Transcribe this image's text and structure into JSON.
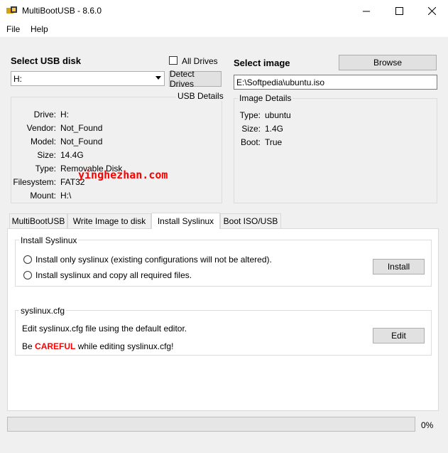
{
  "window": {
    "title": "MultiBootUSB - 8.6.0",
    "minimize_icon": "minimize-icon",
    "maximize_icon": "maximize-icon",
    "close_icon": "close-icon"
  },
  "menu": {
    "file": "File",
    "help": "Help"
  },
  "usb": {
    "heading": "Select USB disk",
    "selected": "H:",
    "all_drives_label": "All Drives",
    "all_drives_checked": false,
    "detect_button": "Detect Drives",
    "details_title": "USB Details",
    "fields": [
      {
        "label": "Drive:",
        "value": "H:"
      },
      {
        "label": "Vendor:",
        "value": "Not_Found"
      },
      {
        "label": "Model:",
        "value": "Not_Found"
      },
      {
        "label": "Size:",
        "value": "14.4G"
      },
      {
        "label": "Type:",
        "value": "Removable Disk"
      },
      {
        "label": "Filesystem:",
        "value": "FAT32"
      },
      {
        "label": "Mount:",
        "value": "H:\\"
      }
    ]
  },
  "image": {
    "heading": "Select image",
    "browse_button": "Browse",
    "path": "E:\\Softpedia\\ubuntu.iso",
    "details_title": "Image Details",
    "fields": [
      {
        "label": "Type:",
        "value": "ubuntu"
      },
      {
        "label": "Size:",
        "value": "1.4G"
      },
      {
        "label": "Boot:",
        "value": "True"
      }
    ]
  },
  "watermark": "yinghezhan.com",
  "tabs": [
    {
      "label": "MultiBootUSB"
    },
    {
      "label": "Write Image to disk"
    },
    {
      "label": "Install Syslinux"
    },
    {
      "label": "Boot ISO/USB"
    }
  ],
  "syslinux": {
    "group_title": "Install Syslinux",
    "option1": "Install only syslinux (existing configurations will not be altered).",
    "option2": "Install syslinux and copy all required files.",
    "install_button": "Install"
  },
  "cfg": {
    "group_title": "syslinux.cfg",
    "description": "Edit syslinux.cfg file using the default editor.",
    "warn_prefix": "Be",
    "warn_word": "CAREFUL",
    "warn_suffix": "while editing syslinux.cfg!",
    "edit_button": "Edit"
  },
  "progress": {
    "percent_label": "0%",
    "value": 0
  },
  "colors": {
    "warning": "#ff0000",
    "watermark": "#ff0000"
  }
}
